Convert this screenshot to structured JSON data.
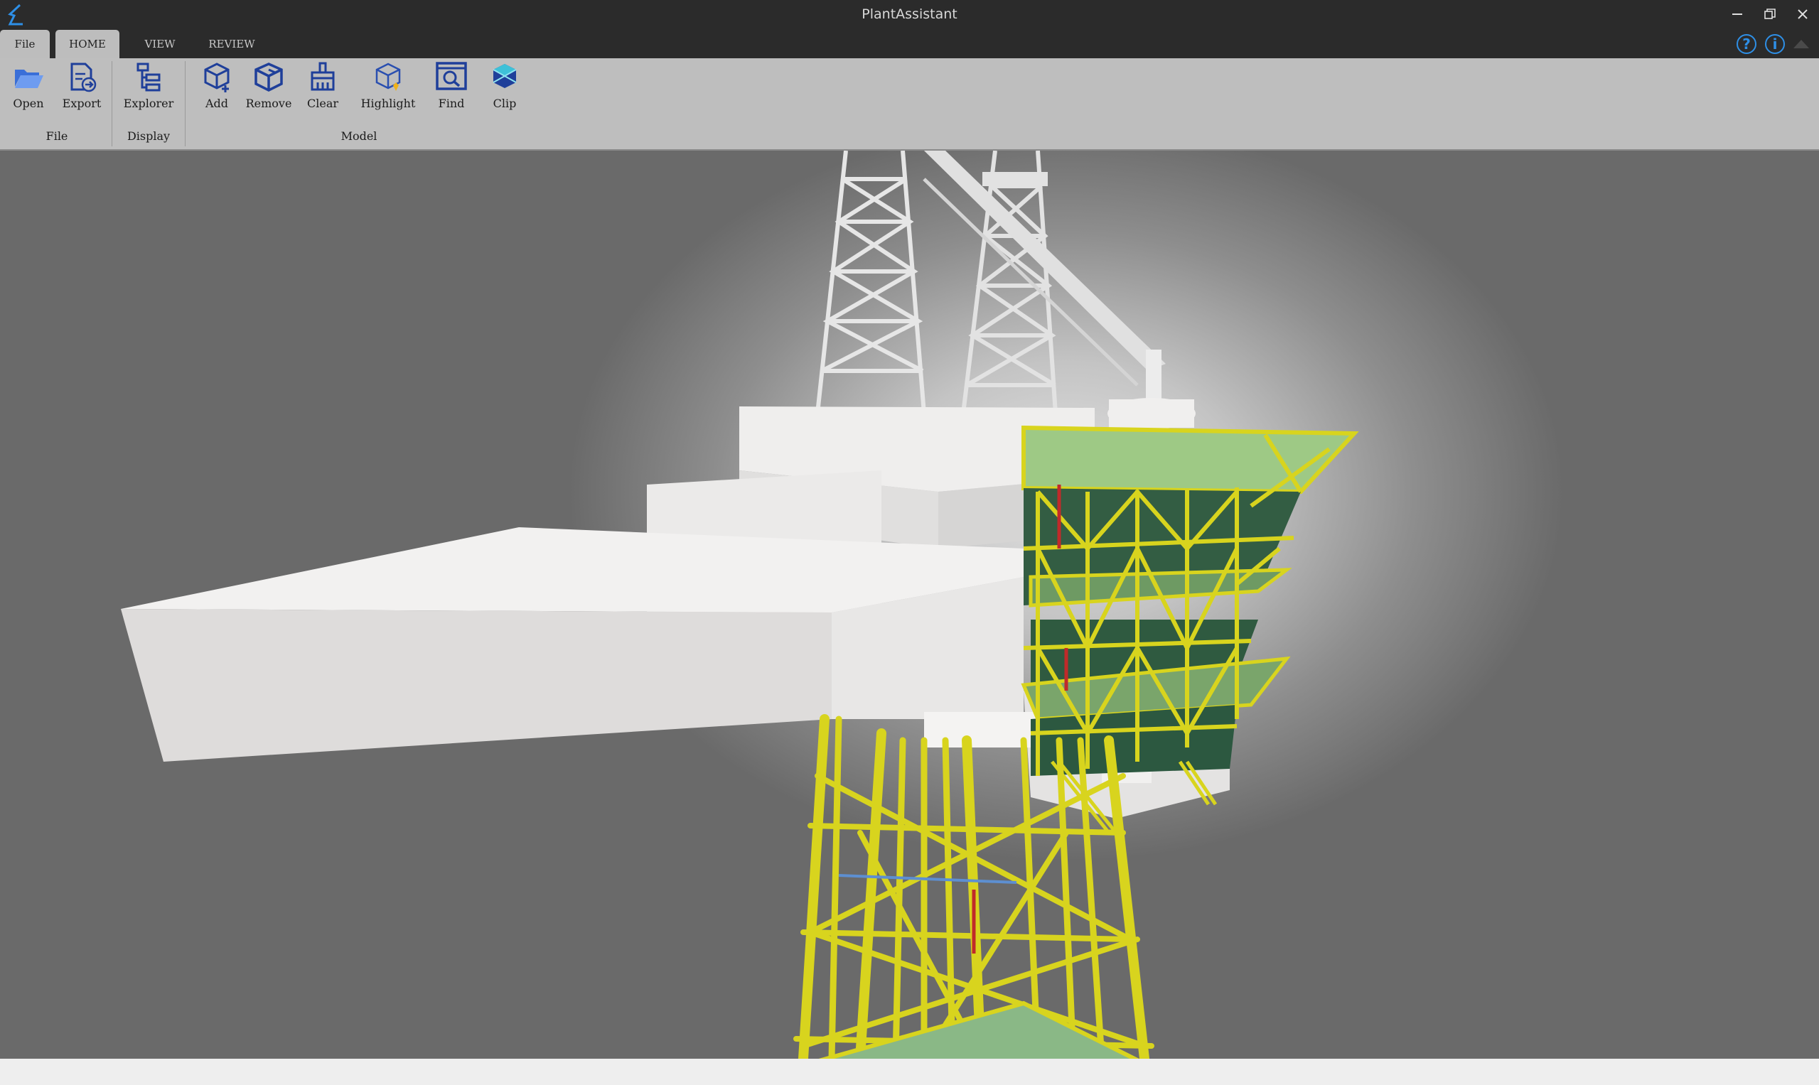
{
  "window": {
    "title": "PlantAssistant",
    "controls": [
      "minimize",
      "restore",
      "close"
    ]
  },
  "tabs": [
    {
      "label": "File",
      "active": false
    },
    {
      "label": "HOME",
      "active": true
    },
    {
      "label": "VIEW",
      "active": false
    },
    {
      "label": "REVIEW",
      "active": false
    }
  ],
  "ribbon": {
    "groups": [
      {
        "label": "File",
        "buttons": [
          {
            "label": "Open",
            "icon": "folder-open-icon"
          },
          {
            "label": "Export",
            "icon": "export-icon"
          }
        ]
      },
      {
        "label": "Display",
        "buttons": [
          {
            "label": "Explorer",
            "icon": "explorer-tree-icon"
          }
        ]
      },
      {
        "label": "Model",
        "buttons": [
          {
            "label": "Add",
            "icon": "cube-add-icon"
          },
          {
            "label": "Remove",
            "icon": "cube-remove-icon"
          },
          {
            "label": "Clear",
            "icon": "clear-brush-icon"
          },
          {
            "label": "Highlight",
            "icon": "cube-highlight-icon"
          },
          {
            "label": "Find",
            "icon": "find-icon"
          },
          {
            "label": "Clip",
            "icon": "clip-icon"
          }
        ]
      }
    ]
  },
  "help_icons": [
    "help-icon",
    "info-icon",
    "collapse-ribbon-icon"
  ],
  "colors": {
    "titlebar": "#2b2b2b",
    "ribbon": "#bebebe",
    "icon_blue": "#1f3f9a",
    "accent_blue": "#2e8fe6",
    "structure_yellow": "#d8d41e",
    "module_green": "#3e6b4e",
    "hull_white": "#e8e6e4"
  }
}
